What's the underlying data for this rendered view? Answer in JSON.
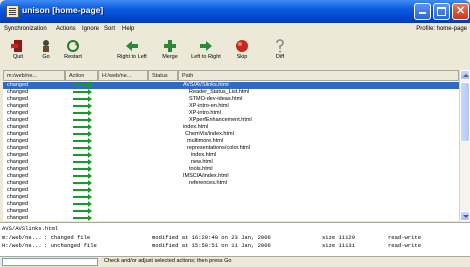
{
  "window": {
    "title": "unison [home-page]"
  },
  "menu": {
    "items": [
      "Synchronization",
      "Actions",
      "Ignore",
      "Sort",
      "Help"
    ],
    "profile": "Profile: home-page"
  },
  "toolbar": {
    "buttons": [
      "Quit",
      "Go",
      "Restart",
      "Right to Left",
      "Merge",
      "Left to Right",
      "Skip",
      "Diff"
    ]
  },
  "columns": [
    "m:/web/ne...",
    "Action",
    "H:/web/ne...",
    "Status",
    "Path"
  ],
  "rows": [
    {
      "status": "changed",
      "path": "AVS/AVSlinks.html"
    },
    {
      "status": "changed",
      "path": "Reader_Status_List.html"
    },
    {
      "status": "changed",
      "path": "STMO-dev-ideas.html"
    },
    {
      "status": "changed",
      "path": "XP-intro-en.html"
    },
    {
      "status": "changed",
      "path": "XP-intro.html"
    },
    {
      "status": "changed",
      "path": "XPperfEnhancement.html"
    },
    {
      "status": "changed",
      "path": "index.html"
    },
    {
      "status": "changed",
      "path": "ChemVis/index.html"
    },
    {
      "status": "changed",
      "path": "multimore.html"
    },
    {
      "status": "changed",
      "path": "representations/color.html"
    },
    {
      "status": "changed",
      "path": "index.html"
    },
    {
      "status": "changed",
      "path": "new.html"
    },
    {
      "status": "changed",
      "path": "tools.html"
    },
    {
      "status": "changed",
      "path": "IMSCIA/index.html"
    },
    {
      "status": "changed",
      "path": "references.html"
    },
    {
      "status": "changed",
      "path": ""
    },
    {
      "status": "changed",
      "path": ""
    },
    {
      "status": "changed",
      "path": ""
    },
    {
      "status": "changed",
      "path": ""
    },
    {
      "status": "changed",
      "path": ""
    }
  ],
  "details": {
    "path": "AVS/AVSlinks.html",
    "lines": [
      {
        "root": "m:/web/ne...",
        "state": ": changed file",
        "modified": "modified at 16:20:40 on 23 Jan, 2006",
        "size": "size 11129",
        "perm": "read-write"
      },
      {
        "root": "H:/web/ne...",
        "state": ": unchanged file",
        "modified": "modified at 15:50:51 on 11 Jan, 2006",
        "size": "size 11131",
        "perm": "read-write"
      }
    ]
  },
  "status_bar": {
    "message": "Check and/or adjust selected actions; then press Go"
  },
  "colors": {
    "selection": "#316ac5",
    "arrow": "#1a9a2a",
    "titlebar": "#0a5ae0"
  }
}
